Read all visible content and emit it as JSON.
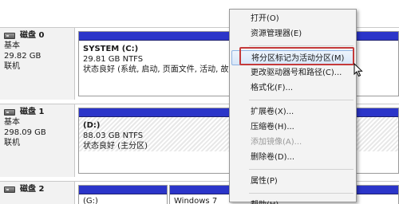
{
  "disks": [
    {
      "title": "磁盘 0",
      "type": "基本",
      "size": "29.82 GB",
      "status": "联机",
      "partitions": [
        {
          "name": "SYSTEM  (C:)",
          "size": "29.81 GB NTFS",
          "status": "状态良好 (系统, 启动, 页面文件, 活动, 故"
        }
      ]
    },
    {
      "title": "磁盘 1",
      "type": "基本",
      "size": "298.09 GB",
      "status": "联机",
      "partitions": [
        {
          "name": "(D:)",
          "size": "88.03 GB NTFS",
          "status": "状态良好 (主分区)"
        }
      ]
    },
    {
      "title": "磁盘 2",
      "partitions": [
        {
          "name": "(G:)"
        },
        {
          "name": "Windows 7"
        }
      ]
    }
  ],
  "context_menu": {
    "items": [
      {
        "label": "打开(O)",
        "enabled": true
      },
      {
        "label": "资源管理器(E)",
        "enabled": true
      },
      {
        "label": "将分区标记为活动分区(M)",
        "enabled": true,
        "highlighted": true
      },
      {
        "label": "更改驱动器号和路径(C)...",
        "enabled": true
      },
      {
        "label": "格式化(F)...",
        "enabled": true
      },
      {
        "label": "扩展卷(X)...",
        "enabled": true
      },
      {
        "label": "压缩卷(H)...",
        "enabled": true
      },
      {
        "label": "添加镜像(A)...",
        "enabled": false
      },
      {
        "label": "删除卷(D)...",
        "enabled": true
      },
      {
        "label": "属性(P)",
        "enabled": true
      },
      {
        "label": "帮助(H)",
        "enabled": true
      }
    ]
  },
  "colors": {
    "primary_partition_band": "#2b35c9",
    "highlight_outline": "#c43a3a"
  },
  "icons": {
    "disk": "hard-disk-icon",
    "cursor": "mouse-pointer-icon"
  }
}
